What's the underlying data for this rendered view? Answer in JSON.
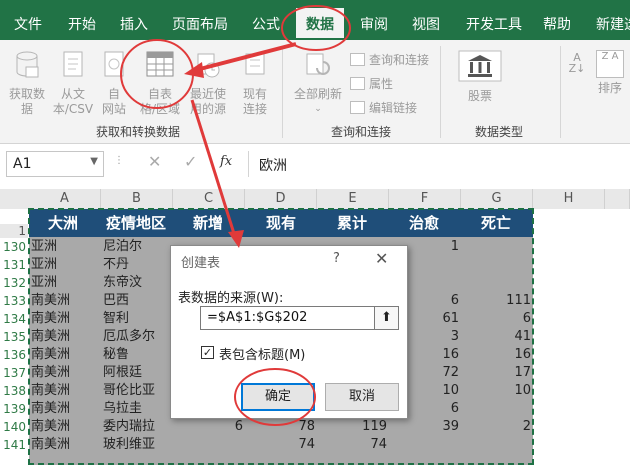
{
  "ribbon_tabs": [
    "文件",
    "开始",
    "插入",
    "页面布局",
    "公式",
    "数据",
    "审阅",
    "视图",
    "开发工具",
    "帮助",
    "新建选"
  ],
  "ribbon": {
    "get_data": "获取数\n据",
    "from_text": "从文\n本/CSV",
    "from_web": "自\n网站",
    "from_table": "自表\n格/区域",
    "recent_sources": "最近使\n用的源",
    "existing_connections": "现有\n连接",
    "refresh_all": "全部刷新",
    "queries_connections": "查询和连接",
    "properties": "属性",
    "edit_links": "编辑链接",
    "stocks": "股票",
    "sort_label": "排序",
    "group_get_transform": "获取和转换数据",
    "group_queries": "查询和连接",
    "group_data_types": "数据类型"
  },
  "formula_bar": {
    "name_box": "A1",
    "fx": "fx",
    "value": "欧洲"
  },
  "sheet": {
    "columns": [
      "A",
      "B",
      "C",
      "D",
      "E",
      "F",
      "G",
      "H"
    ],
    "header_row": {
      "num": "1",
      "cells": [
        "大洲",
        "疫情地区",
        "新增",
        "现有",
        "累计",
        "治愈",
        "死亡"
      ]
    },
    "rows": [
      {
        "num": "130",
        "a": "亚洲",
        "b": "尼泊尔",
        "c": "",
        "d": "",
        "e": "",
        "f": "1",
        "g": ""
      },
      {
        "num": "131",
        "a": "亚洲",
        "b": "不丹",
        "c": "",
        "d": "",
        "e": "",
        "f": "",
        "g": ""
      },
      {
        "num": "132",
        "a": "亚洲",
        "b": "东帝汶",
        "c": "",
        "d": "",
        "e": "",
        "f": "",
        "g": ""
      },
      {
        "num": "133",
        "a": "南美洲",
        "b": "巴西",
        "c": "",
        "d": "",
        "e": "",
        "f": "6",
        "g": "111"
      },
      {
        "num": "134",
        "a": "南美洲",
        "b": "智利",
        "c": "",
        "d": "",
        "e": "",
        "f": "61",
        "g": "6"
      },
      {
        "num": "135",
        "a": "南美洲",
        "b": "厄瓜多尔",
        "c": "",
        "d": "",
        "e": "",
        "f": "3",
        "g": "41"
      },
      {
        "num": "136",
        "a": "南美洲",
        "b": "秘鲁",
        "c": "",
        "d": "",
        "e": "",
        "f": "16",
        "g": "16"
      },
      {
        "num": "137",
        "a": "南美洲",
        "b": "阿根廷",
        "c": "",
        "d": "",
        "e": "",
        "f": "72",
        "g": "17"
      },
      {
        "num": "138",
        "a": "南美洲",
        "b": "哥伦比亚",
        "c": "",
        "d": "",
        "e": "",
        "f": "10",
        "g": "10"
      },
      {
        "num": "139",
        "a": "南美洲",
        "b": "乌拉圭",
        "c": "",
        "d": "",
        "e": "",
        "f": "6",
        "g": ""
      },
      {
        "num": "140",
        "a": "南美洲",
        "b": "委内瑞拉",
        "c": "6",
        "d": "78",
        "e": "119",
        "f": "39",
        "g": "2"
      },
      {
        "num": "141",
        "a": "南美洲",
        "b": "玻利维亚",
        "c": "",
        "d": "74",
        "e": "74",
        "f": "",
        "g": ""
      }
    ]
  },
  "dialog": {
    "title": "创建表",
    "help": "?",
    "close": "✕",
    "source_label": "表数据的来源(W):",
    "range_value": "=$A$1:$G$202",
    "picker_icon": "range-picker-icon",
    "has_headers_label": "表包含标题(M)",
    "has_headers_checked": true,
    "ok": "确定",
    "cancel": "取消"
  },
  "colors": {
    "excel_green": "#217346",
    "header_fill": "#1f4e79",
    "annotation_red": "#e03a3a",
    "dialog_focus": "#0078d7"
  }
}
